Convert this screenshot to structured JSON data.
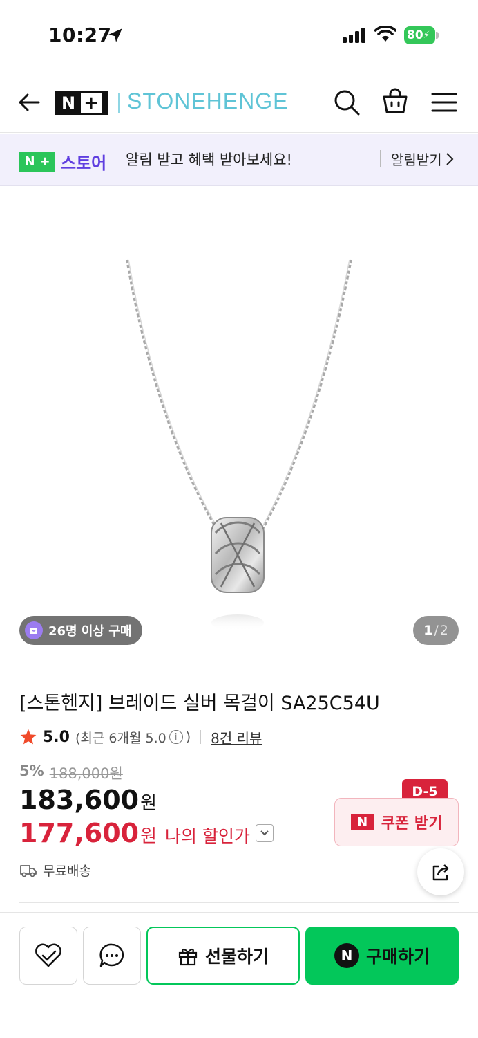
{
  "status_bar": {
    "time": "10:27",
    "battery": "80"
  },
  "header": {
    "logo_n": "N",
    "logo_plus": "+",
    "brand": "STONEHENGE"
  },
  "banner": {
    "store_label": "스토어",
    "store_n": "N",
    "store_plus": "+",
    "message": "알림 받고 혜택 받아보세요!",
    "action": "알림받기"
  },
  "gallery": {
    "buyers_badge": "26명 이상 구매",
    "page_current": "1",
    "page_separator": "/",
    "page_total": "2"
  },
  "product": {
    "title": "[스톤헨지] 브레이드 실버 목걸이 SA25C54U",
    "rating": "5.0",
    "rating_recent_prefix": "(최근 6개월 5.0",
    "rating_recent_suffix": ")",
    "info_glyph": "i",
    "review_count": "8건 리뷰",
    "discount_rate": "5%",
    "original_price": "188,000원",
    "sale_price": "183,600",
    "currency": "원",
    "my_price": "177,600",
    "my_price_label": "나의 할인가",
    "shipping": "무료배송"
  },
  "coupon": {
    "label": "쿠폰 받기",
    "n_mark": "N",
    "dday": "D-5"
  },
  "bottom_bar": {
    "gift_label": "선물하기",
    "buy_label": "구매하기",
    "buy_n": "N"
  },
  "colors": {
    "naver_green": "#03c75a",
    "discount_red": "#d8233b",
    "store_purple": "#5f3ee0",
    "brand_teal": "#5fc4d6"
  }
}
